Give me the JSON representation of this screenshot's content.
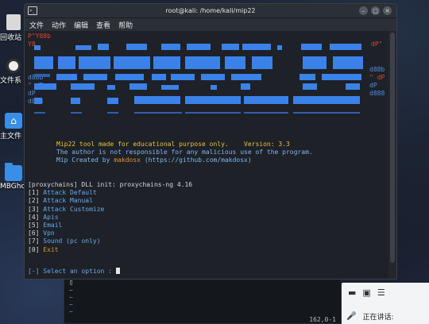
{
  "desktop": {
    "icons": [
      {
        "label": "回收站",
        "kind": "trash"
      },
      {
        "label": "文件系",
        "kind": "files"
      },
      {
        "label": "主文件",
        "kind": "home"
      },
      {
        "label": "MBGhos",
        "kind": "folder"
      }
    ]
  },
  "window": {
    "title": "root@kali: /home/kali/mip22",
    "menu": [
      "文件",
      "动作",
      "编辑",
      "查看",
      "帮助"
    ],
    "controls": {
      "minimize": "–",
      "maximize": "□",
      "close": "✕"
    }
  },
  "banner": {
    "left_lines": [
      "P\"Y88b",
      "  Y8",
      "",
      "d88b",
      "\" dP",
      "dP",
      "d888"
    ],
    "right_lines": [
      "dP\"",
      "",
      "d88b",
      "\" dP",
      "dP",
      "d888"
    ],
    "colors": {
      "red": "#e0443a",
      "blue": "#3b82e8"
    }
  },
  "info": {
    "line1": "Mip22 tool made for educational purpose only.",
    "version": "Version: 3.3",
    "line2": "The author is not responsible for any malicious use of the program.",
    "line3_prefix": "Mip Created by",
    "author": "makdosx",
    "line3_suffix": "(https://github.com/makdosx)"
  },
  "proxychains": "[proxychains] DLL init: proxychains-ng 4.16",
  "options": [
    {
      "num": "[1]",
      "label": "Attack Default"
    },
    {
      "num": "[2]",
      "label": "Attack Manual"
    },
    {
      "num": "[3]",
      "label": "Attack Customize"
    },
    {
      "num": "[4]",
      "label": "Apis"
    },
    {
      "num": "[5]",
      "label": "Email"
    },
    {
      "num": "[6]",
      "label": "Vpn"
    },
    {
      "num": "[7]",
      "label": "Sound (pc only)"
    },
    {
      "num": "[0]",
      "label": "Exit"
    }
  ],
  "prompt": "[-] Select an option : ",
  "background_terminal": {
    "tildes": [
      "~",
      "~",
      "~",
      "~"
    ],
    "position": "162,0-1"
  },
  "panel": {
    "speaking_label": "正在讲话:"
  }
}
